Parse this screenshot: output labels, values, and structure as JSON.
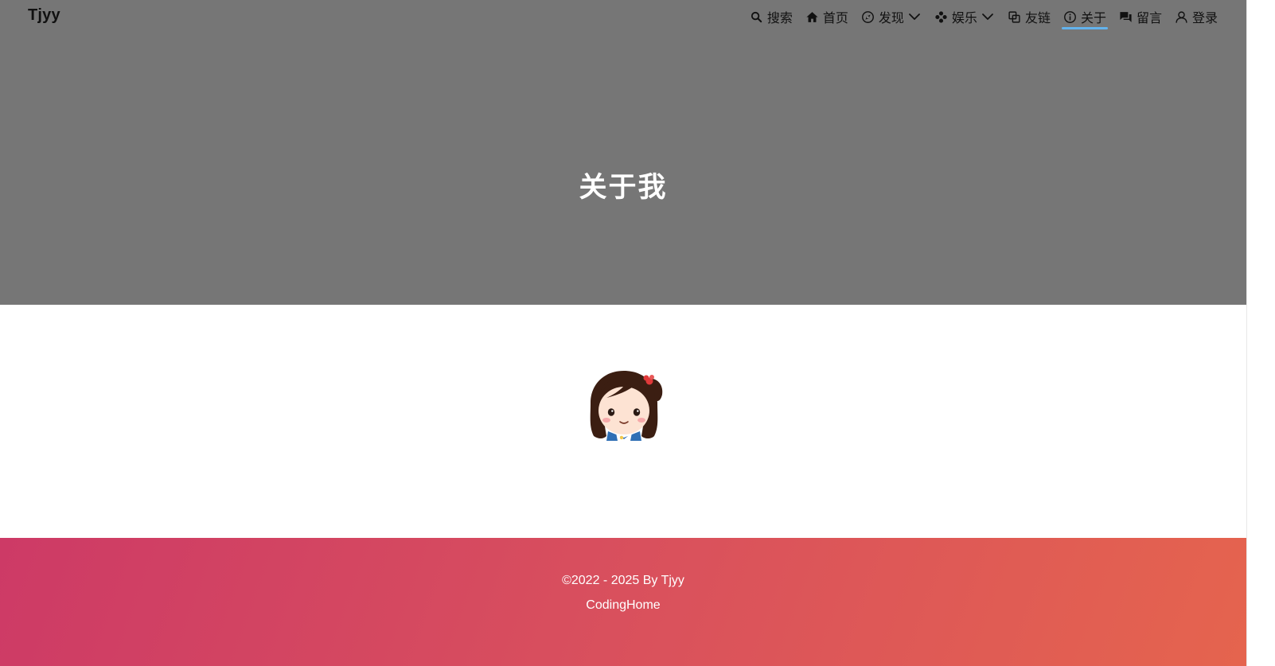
{
  "brand": "Tjyy",
  "nav": {
    "search": "搜索",
    "home": "首页",
    "discover": "发现",
    "entertainment": "娱乐",
    "links": "友链",
    "about": "关于",
    "message": "留言",
    "login": "登录"
  },
  "hero": {
    "title": "关于我"
  },
  "footer": {
    "copyright": "©2022 - 2025 By Tjyy",
    "site": "CodingHome"
  },
  "colors": {
    "hero_bg": "#767676",
    "active_underline": "#63b3ed",
    "footer_gradient_start": "#cd3a66",
    "footer_gradient_end": "#e5644e"
  },
  "icons": {
    "search": "search-icon",
    "home": "home-icon",
    "discover": "compass-icon",
    "entertainment": "gamepad-icon",
    "links": "link-icon",
    "about": "info-icon",
    "message": "chat-icon",
    "login": "user-icon",
    "dropdown": "chevron-down-icon"
  }
}
